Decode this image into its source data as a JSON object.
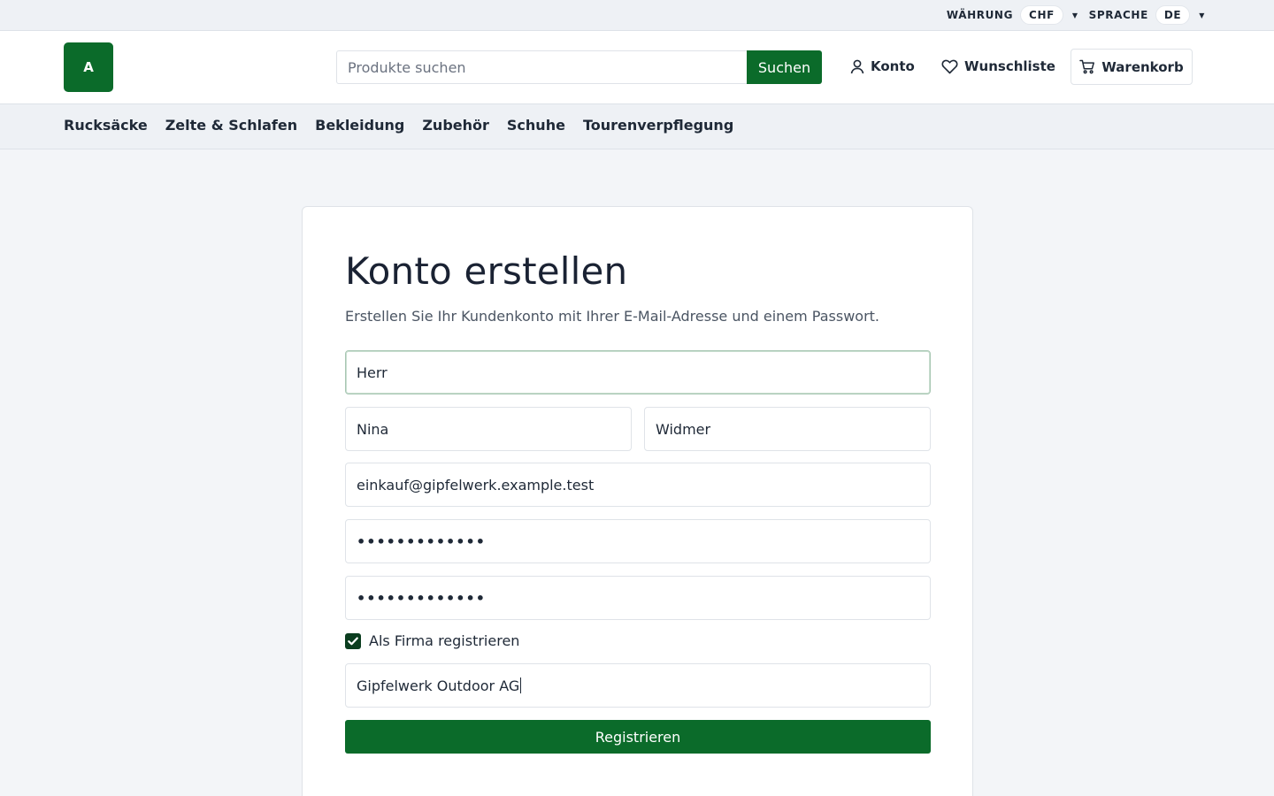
{
  "utility": {
    "currency_label": "WÄHRUNG",
    "currency_value": "CHF",
    "language_label": "SPRACHE",
    "language_value": "DE"
  },
  "header": {
    "logo_text": "A",
    "search_placeholder": "Produkte suchen",
    "search_button": "Suchen",
    "account": "Konto",
    "wishlist": "Wunschliste",
    "cart": "Warenkorb"
  },
  "categories": [
    "Rucksäcke",
    "Zelte & Schlafen",
    "Bekleidung",
    "Zubehör",
    "Schuhe",
    "Tourenverpflegung"
  ],
  "form": {
    "title": "Konto erstellen",
    "subtitle": "Erstellen Sie Ihr Kundenkonto mit Ihrer E-Mail-Adresse und einem Passwort.",
    "salutation": "Herr",
    "first_name": "Nina",
    "last_name": "Widmer",
    "email": "einkauf@gipfelwerk.example.test",
    "password_mask": "•••••••••••••",
    "password_confirm_mask": "•••••••••••••",
    "company_checkbox_label": "Als Firma registrieren",
    "company_checked": true,
    "company_name": "Gipfelwerk Outdoor AG",
    "submit": "Registrieren"
  },
  "colors": {
    "brand_green": "#0b6b2a",
    "checkbox_dark": "#0b3d1f"
  }
}
